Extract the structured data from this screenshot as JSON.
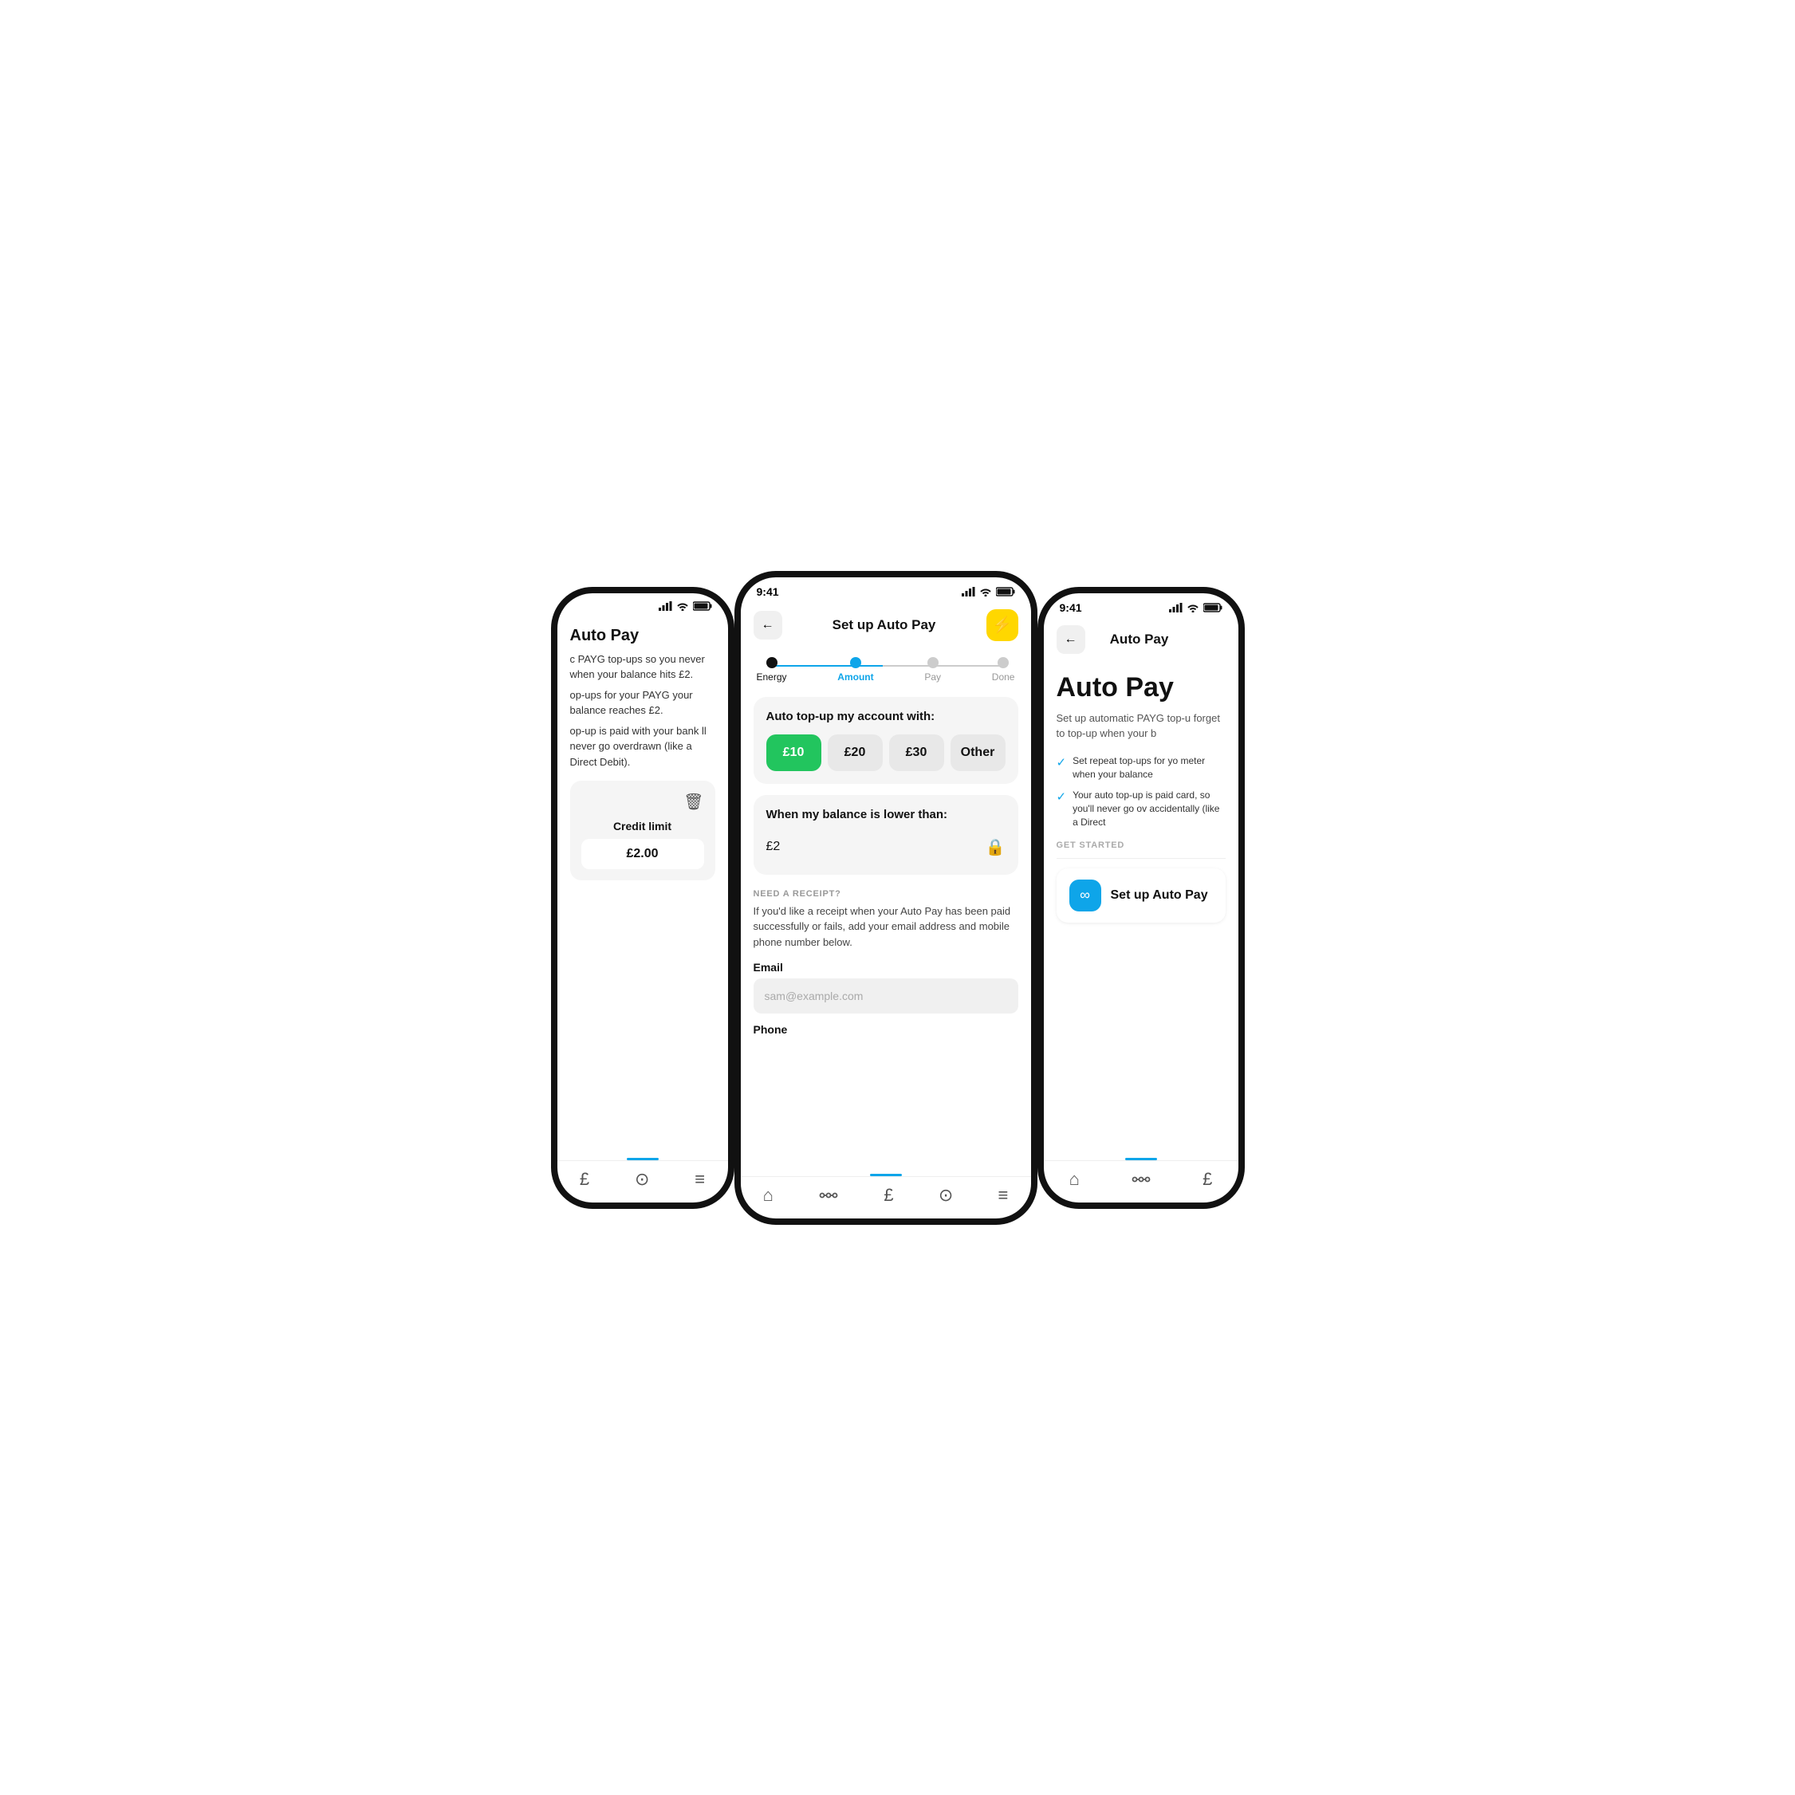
{
  "scene": {
    "background": "#ffffff"
  },
  "phone_left": {
    "status_bar": {
      "signal": "▪▪▪▪",
      "wifi": "wifi",
      "battery": "battery"
    },
    "title": "Auto Pay",
    "description_1": "c PAYG top-ups so you never when your balance hits £2.",
    "description_2": "op-ups for your PAYG your balance reaches £2.",
    "description_3": "op-up is paid with your bank ll never go overdrawn (like a Direct Debit).",
    "credit_section": {
      "trash_label": "🗑",
      "credit_title": "Credit limit",
      "credit_value": "£2.00"
    },
    "bottom_nav": {
      "items": [
        "£",
        "?",
        "≡"
      ]
    }
  },
  "phone_center": {
    "status_bar": {
      "time": "9:41"
    },
    "header": {
      "back_label": "←",
      "title": "Set up Auto Pay",
      "lightning": "⚡"
    },
    "stepper": {
      "steps": [
        {
          "label": "Energy",
          "state": "done"
        },
        {
          "label": "Amount",
          "state": "active"
        },
        {
          "label": "Pay",
          "state": "inactive"
        },
        {
          "label": "Done",
          "state": "inactive"
        }
      ]
    },
    "amount_card": {
      "title": "Auto top-up my account with:",
      "buttons": [
        {
          "label": "£10",
          "selected": true
        },
        {
          "label": "£20",
          "selected": false
        },
        {
          "label": "£30",
          "selected": false
        },
        {
          "label": "Other",
          "selected": false
        }
      ]
    },
    "balance_card": {
      "title": "When my balance is lower than:",
      "value": "£2",
      "lock_icon": "🔒"
    },
    "receipt_section": {
      "label": "NEED A RECEIPT?",
      "description": "If you'd like a receipt when your Auto Pay has been paid successfully or fails, add your email address and mobile phone number below.",
      "email_label": "Email",
      "email_placeholder": "sam@example.com",
      "phone_label": "Phone"
    },
    "bottom_nav": {
      "items": [
        "🏠",
        "⬡",
        "£",
        "?",
        "≡"
      ]
    }
  },
  "phone_right": {
    "status_bar": {
      "time": "9:41"
    },
    "header": {
      "back_label": "←",
      "title": "Auto Pay"
    },
    "auto_pay": {
      "title": "Auto Pay",
      "description": "Set up automatic PAYG top-u forget to top-up when your b",
      "bullets": [
        "Set repeat top-ups for yo meter when your balance",
        "Your auto top-up is paid card, so you'll never go ov accidentally (like a Direct"
      ],
      "get_started_label": "GET STARTED",
      "setup_button": {
        "icon": "∞",
        "label": "Set up Auto Pay"
      }
    },
    "bottom_nav": {
      "items": [
        "🏠",
        "⬡",
        "£"
      ]
    }
  }
}
